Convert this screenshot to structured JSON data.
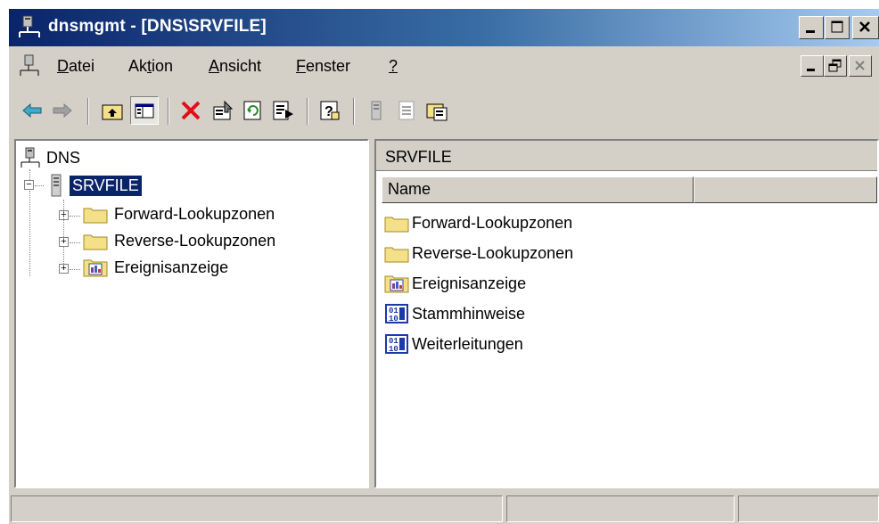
{
  "window": {
    "title": "dnsmgmt - [DNS\\SRVFILE]",
    "caption_buttons": [
      "minimize",
      "maximize",
      "close"
    ]
  },
  "menu": {
    "items": [
      {
        "pre": "",
        "ul": "D",
        "post": "atei"
      },
      {
        "pre": "Ak",
        "ul": "t",
        "post": "ion"
      },
      {
        "pre": "",
        "ul": "A",
        "post": "nsicht"
      },
      {
        "pre": "",
        "ul": "F",
        "post": "enster"
      },
      {
        "pre": "",
        "ul": "?",
        "post": ""
      }
    ]
  },
  "toolbar": {
    "icons": [
      "back-arrow-icon",
      "forward-arrow-icon",
      "up-folder-icon",
      "show-hide-tree-icon",
      "delete-icon",
      "properties-icon",
      "refresh-icon",
      "export-list-icon",
      "help-icon",
      "server-icon",
      "records-icon",
      "new-zone-icon"
    ]
  },
  "tree": {
    "root": "DNS",
    "server": "SRVFILE",
    "children": [
      "Forward-Lookupzonen",
      "Reverse-Lookupzonen",
      "Ereignisanzeige"
    ]
  },
  "details": {
    "header": "SRVFILE",
    "column_name": "Name",
    "items": [
      {
        "label": "Forward-Lookupzonen",
        "icon": "folder-icon"
      },
      {
        "label": "Reverse-Lookupzonen",
        "icon": "folder-icon"
      },
      {
        "label": "Ereignisanzeige",
        "icon": "event-viewer-icon"
      },
      {
        "label": "Stammhinweise",
        "icon": "root-hints-icon"
      },
      {
        "label": "Weiterleitungen",
        "icon": "forwarders-icon"
      }
    ]
  },
  "colors": {
    "title_start": "#0a246a",
    "title_end": "#a6caf0",
    "selection": "#0a246a",
    "chrome": "#d4d0c8",
    "folder": "#f5e08a"
  }
}
